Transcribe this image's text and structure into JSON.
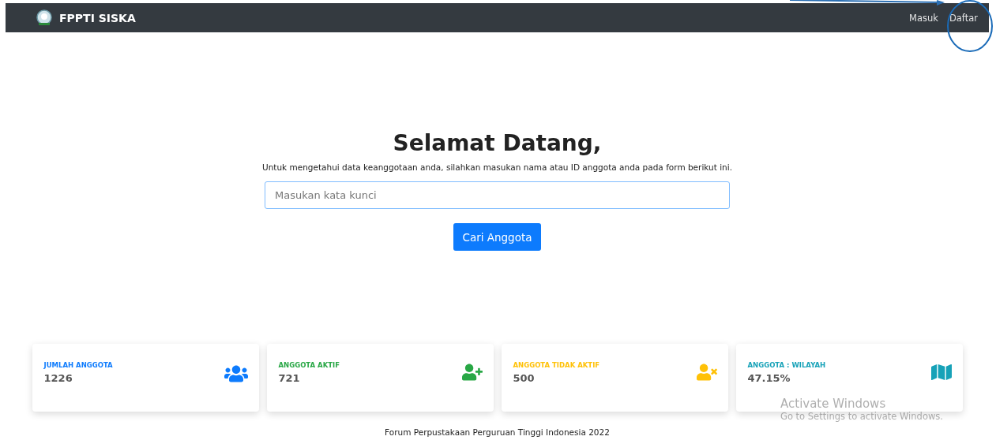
{
  "navbar": {
    "brand": "FPPTI SISKA",
    "links": [
      {
        "label": "Masuk"
      },
      {
        "label": "Daftar"
      }
    ]
  },
  "hero": {
    "title": "Selamat Datang,",
    "subtitle": "Untuk mengetahui data keanggotaan anda, silahkan masukan nama atau ID anggota anda pada form berikut ini.",
    "search": {
      "placeholder": "Masukan kata kunci"
    },
    "button": "Cari Anggota"
  },
  "stats": [
    {
      "label": "JUMLAH ANGGOTA",
      "value": "1226",
      "kind": "users",
      "color": "#0d7bfd"
    },
    {
      "label": "ANGGOTA AKTIF",
      "value": "721",
      "kind": "user-plus",
      "color": "#28a745"
    },
    {
      "label": "ANGGOTA TIDAK AKTIF",
      "value": "500",
      "kind": "user-x",
      "color": "#ffc107"
    },
    {
      "label": "ANGGOTA : WILAYAH",
      "value": "47.15%",
      "kind": "map",
      "color": "#17a2b8"
    }
  ],
  "footer": "Forum Perpustakaan Perguruan Tinggi Indonesia 2022",
  "os_overlay": {
    "title": "Activate Windows",
    "subtitle": "Go to Settings to activate Windows."
  }
}
